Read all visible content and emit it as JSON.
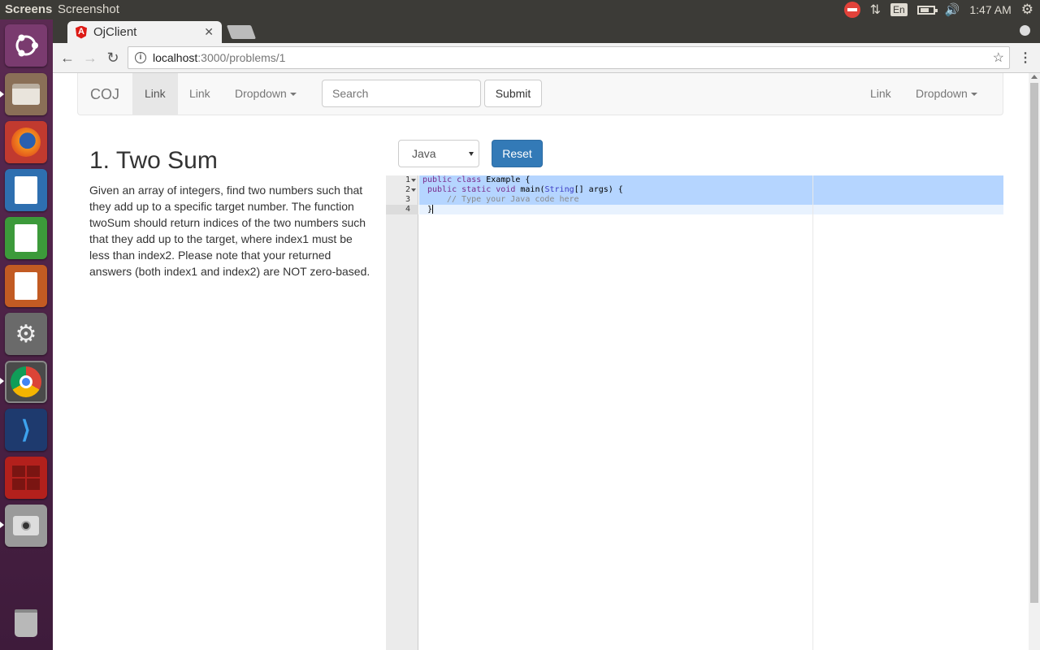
{
  "top_panel": {
    "app_name": "Screens",
    "window_title": "Screenshot",
    "language": "En",
    "clock": "1:47 AM"
  },
  "browser": {
    "tab_title": "OjClient",
    "url_host": "localhost",
    "url_path": ":3000/problems/1"
  },
  "navbar": {
    "brand": "COJ",
    "left_links": [
      "Link",
      "Link"
    ],
    "dropdown_left": "Dropdown",
    "search_placeholder": "Search",
    "submit_label": "Submit",
    "right_link": "Link",
    "dropdown_right": "Dropdown"
  },
  "problem": {
    "title": "1. Two Sum",
    "description": "Given an array of integers, find two numbers such that they add up to a specific target number. The function twoSum should return indices of the two numbers such that they add up to the target, where index1 must be less than index2. Please note that your returned answers (both index1 and index2) are NOT zero-based."
  },
  "editor": {
    "language": "Java",
    "reset_label": "Reset",
    "line_numbers": [
      "1",
      "2",
      "3",
      "4"
    ],
    "code": {
      "l1_kw": "public class",
      "l1_rest": " Example {",
      "l2_kw": "public static void",
      "l2_rest": " main(",
      "l2_type": "String",
      "l2_end": "[] args) {",
      "l3_comment": "// Type your Java code here",
      "l4": "}"
    }
  },
  "colors": {
    "launcher_bg": "#5b2a52",
    "primary_button": "#337ab7",
    "selection": "#b5d5ff"
  }
}
